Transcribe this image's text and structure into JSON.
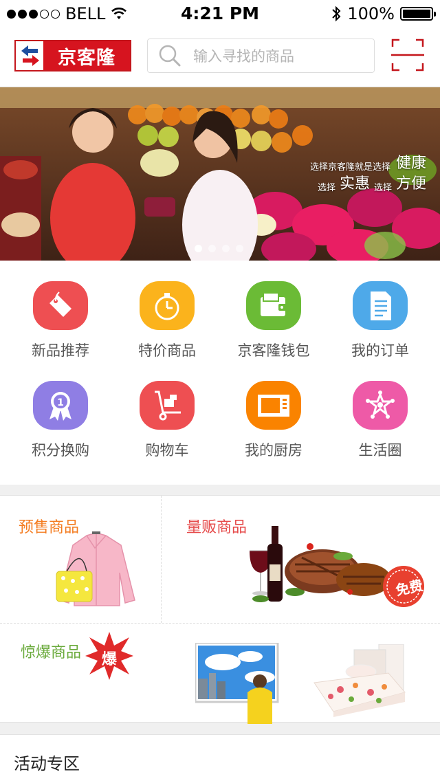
{
  "status_bar": {
    "carrier": "BELL",
    "time": "4:21 PM",
    "battery": "100%",
    "signal_bars": 3,
    "signal_total": 5
  },
  "header": {
    "logo_text": "京客隆",
    "search_placeholder": "输入寻找的商品",
    "brand_color": "#d6141f"
  },
  "banner": {
    "slogan_line1_small": "选择京客隆就是选择",
    "slogan_line1_big": "健康",
    "slogan_line2_small_a": "选择",
    "slogan_line2_big_a": "实惠",
    "slogan_line2_small_b": "选择",
    "slogan_line2_big_b": "方便",
    "page_count": 4,
    "active_page": 0
  },
  "menu": [
    {
      "label": "新品推荐",
      "icon": "tag-icon",
      "color": "#ee4f52"
    },
    {
      "label": "特价商品",
      "icon": "stopwatch-icon",
      "color": "#fbb31c"
    },
    {
      "label": "京客隆钱包",
      "icon": "wallet-icon",
      "color": "#6bbb36"
    },
    {
      "label": "我的订单",
      "icon": "document-icon",
      "color": "#4ea9e9"
    },
    {
      "label": "积分换购",
      "icon": "medal-icon",
      "color": "#8f7ee4"
    },
    {
      "label": "购物车",
      "icon": "hand-truck-icon",
      "color": "#ee4f52"
    },
    {
      "label": "我的厨房",
      "icon": "microwave-icon",
      "color": "#fa8300"
    },
    {
      "label": "生活圈",
      "icon": "star-icon",
      "color": "#ee5aa7"
    }
  ],
  "products": {
    "presale": {
      "title": "预售商品",
      "color": "#f47c20"
    },
    "bulk": {
      "title": "量贩商品",
      "color": "#e64c4c",
      "badge": "免费"
    },
    "surprise": {
      "title": "惊爆商品",
      "color": "#6aaa3b",
      "badge": "爆"
    }
  },
  "activity": {
    "title": "活动专区"
  }
}
